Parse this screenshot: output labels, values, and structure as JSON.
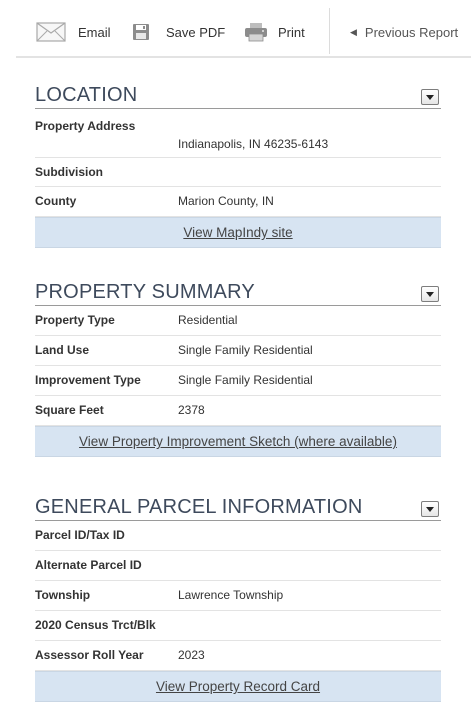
{
  "toolbar": {
    "email_label": "Email",
    "save_pdf_label": "Save PDF",
    "print_label": "Print",
    "previous_label": "Previous Report"
  },
  "location": {
    "title": "LOCATION",
    "rows": [
      {
        "label": "Property Address",
        "value": "Indianapolis, IN 46235-6143"
      },
      {
        "label": "Subdivision",
        "value": ""
      },
      {
        "label": "County",
        "value": "Marion County, IN"
      }
    ],
    "action_label": "View MapIndy site"
  },
  "summary": {
    "title": "PROPERTY SUMMARY",
    "rows": [
      {
        "label": "Property Type",
        "value": "Residential"
      },
      {
        "label": "Land Use",
        "value": "Single Family Residential"
      },
      {
        "label": "Improvement Type",
        "value": "Single Family Residential"
      },
      {
        "label": "Square Feet",
        "value": "2378"
      }
    ],
    "action_label": "View Property Improvement Sketch (where available)"
  },
  "parcel": {
    "title": "GENERAL PARCEL INFORMATION",
    "rows": [
      {
        "label": "Parcel ID/Tax ID",
        "value": ""
      },
      {
        "label": "Alternate Parcel ID",
        "value": ""
      },
      {
        "label": "Township",
        "value": "Lawrence Township"
      },
      {
        "label": "2020 Census Trct/Blk",
        "value": ""
      },
      {
        "label": "Assessor Roll Year",
        "value": "2023"
      }
    ],
    "action_label": "View Property Record Card"
  }
}
